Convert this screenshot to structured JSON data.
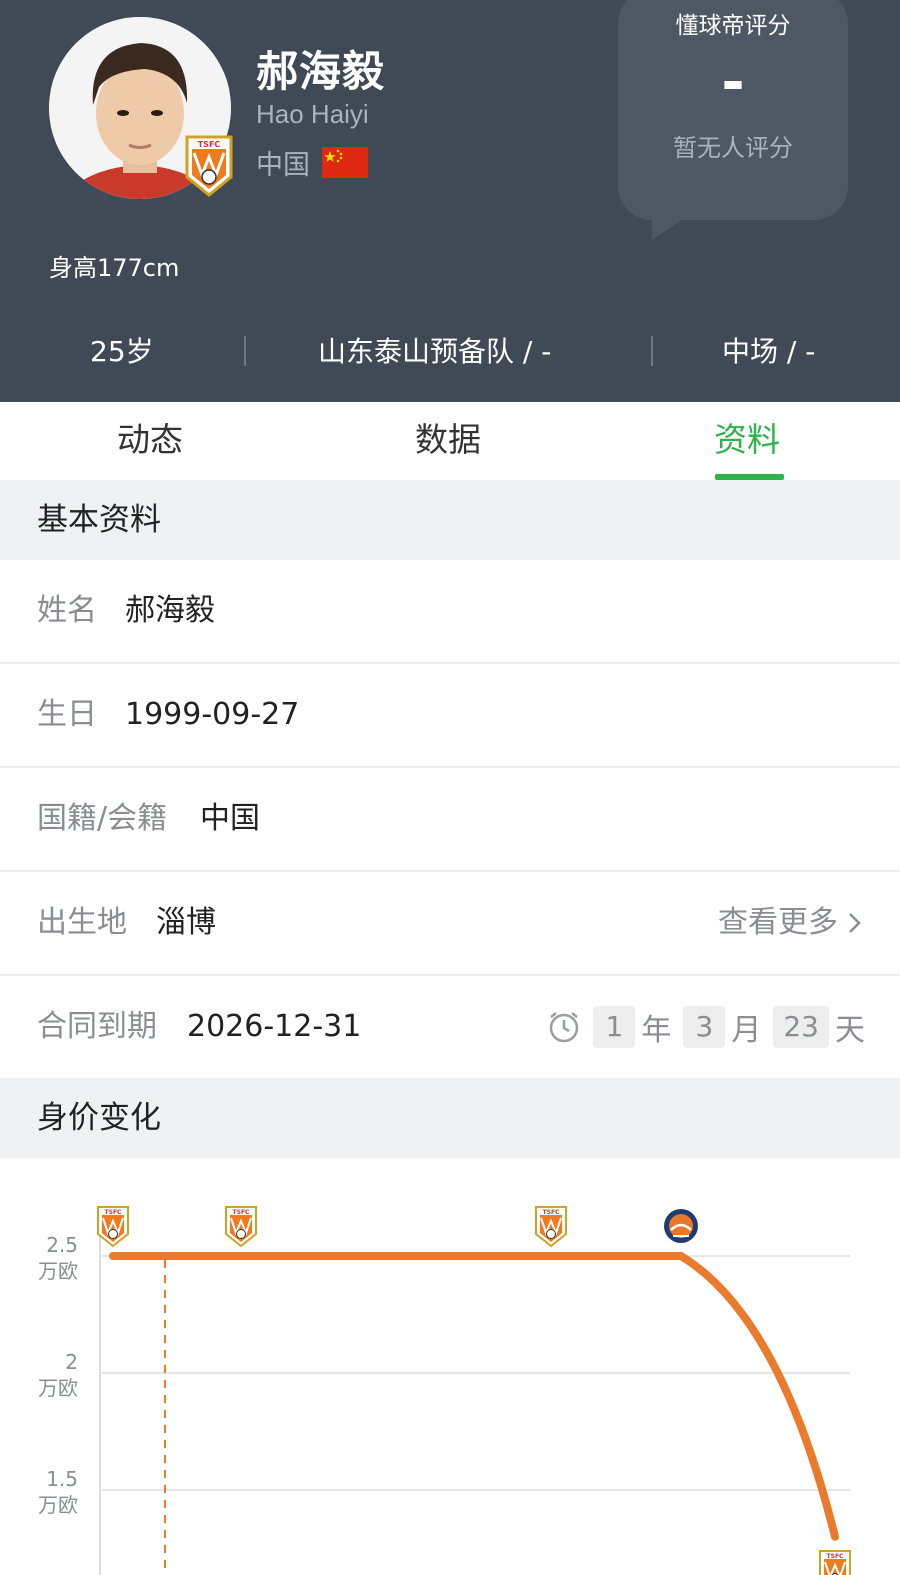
{
  "player": {
    "name_cn": "郝海毅",
    "name_en": "Hao Haiyi",
    "nationality": "中国",
    "height": "身高177cm",
    "club_badge_text": "TSFC"
  },
  "rating": {
    "title": "懂球帝评分",
    "value": "-",
    "sub": "暂无人评分"
  },
  "stats": {
    "age": "25岁",
    "club": "山东泰山预备队 / -",
    "position": "中场 / -"
  },
  "tabs": [
    {
      "label": "动态",
      "active": false
    },
    {
      "label": "数据",
      "active": false
    },
    {
      "label": "资料",
      "active": true
    }
  ],
  "colors": {
    "header_bg": "#3f4a56",
    "accent_green": "#2db34a",
    "chart_line": "#ea7a2c"
  },
  "basic_info": {
    "title": "基本资料",
    "name_label": "姓名",
    "name_value": "郝海毅",
    "birthday_label": "生日",
    "birthday_value": "1999-09-27",
    "nationality_label": "国籍/会籍",
    "nationality_value": "中国",
    "birthplace_label": "出生地",
    "birthplace_value": "淄博",
    "more_label": "查看更多",
    "contract_label": "合同到期",
    "contract_value": "2026-12-31",
    "countdown": {
      "years": "1",
      "years_unit": "年",
      "months": "3",
      "months_unit": "月",
      "days": "23",
      "days_unit": "天"
    }
  },
  "value_section": {
    "title": "身价变化"
  },
  "chart_data": {
    "type": "line",
    "y_ticks": [
      {
        "value": "2.5",
        "unit": "万欧"
      },
      {
        "value": "2",
        "unit": "万欧"
      },
      {
        "value": "1.5",
        "unit": "万欧"
      }
    ],
    "ylim": [
      1.5,
      2.5
    ],
    "series": [
      {
        "values": [
          2.5,
          2.5,
          2.5,
          2.5,
          1.3
        ]
      }
    ],
    "club_markers": [
      "TSFC",
      "TSFC",
      "TSFC",
      "BURNEY",
      "TSFC"
    ],
    "grid": true
  }
}
